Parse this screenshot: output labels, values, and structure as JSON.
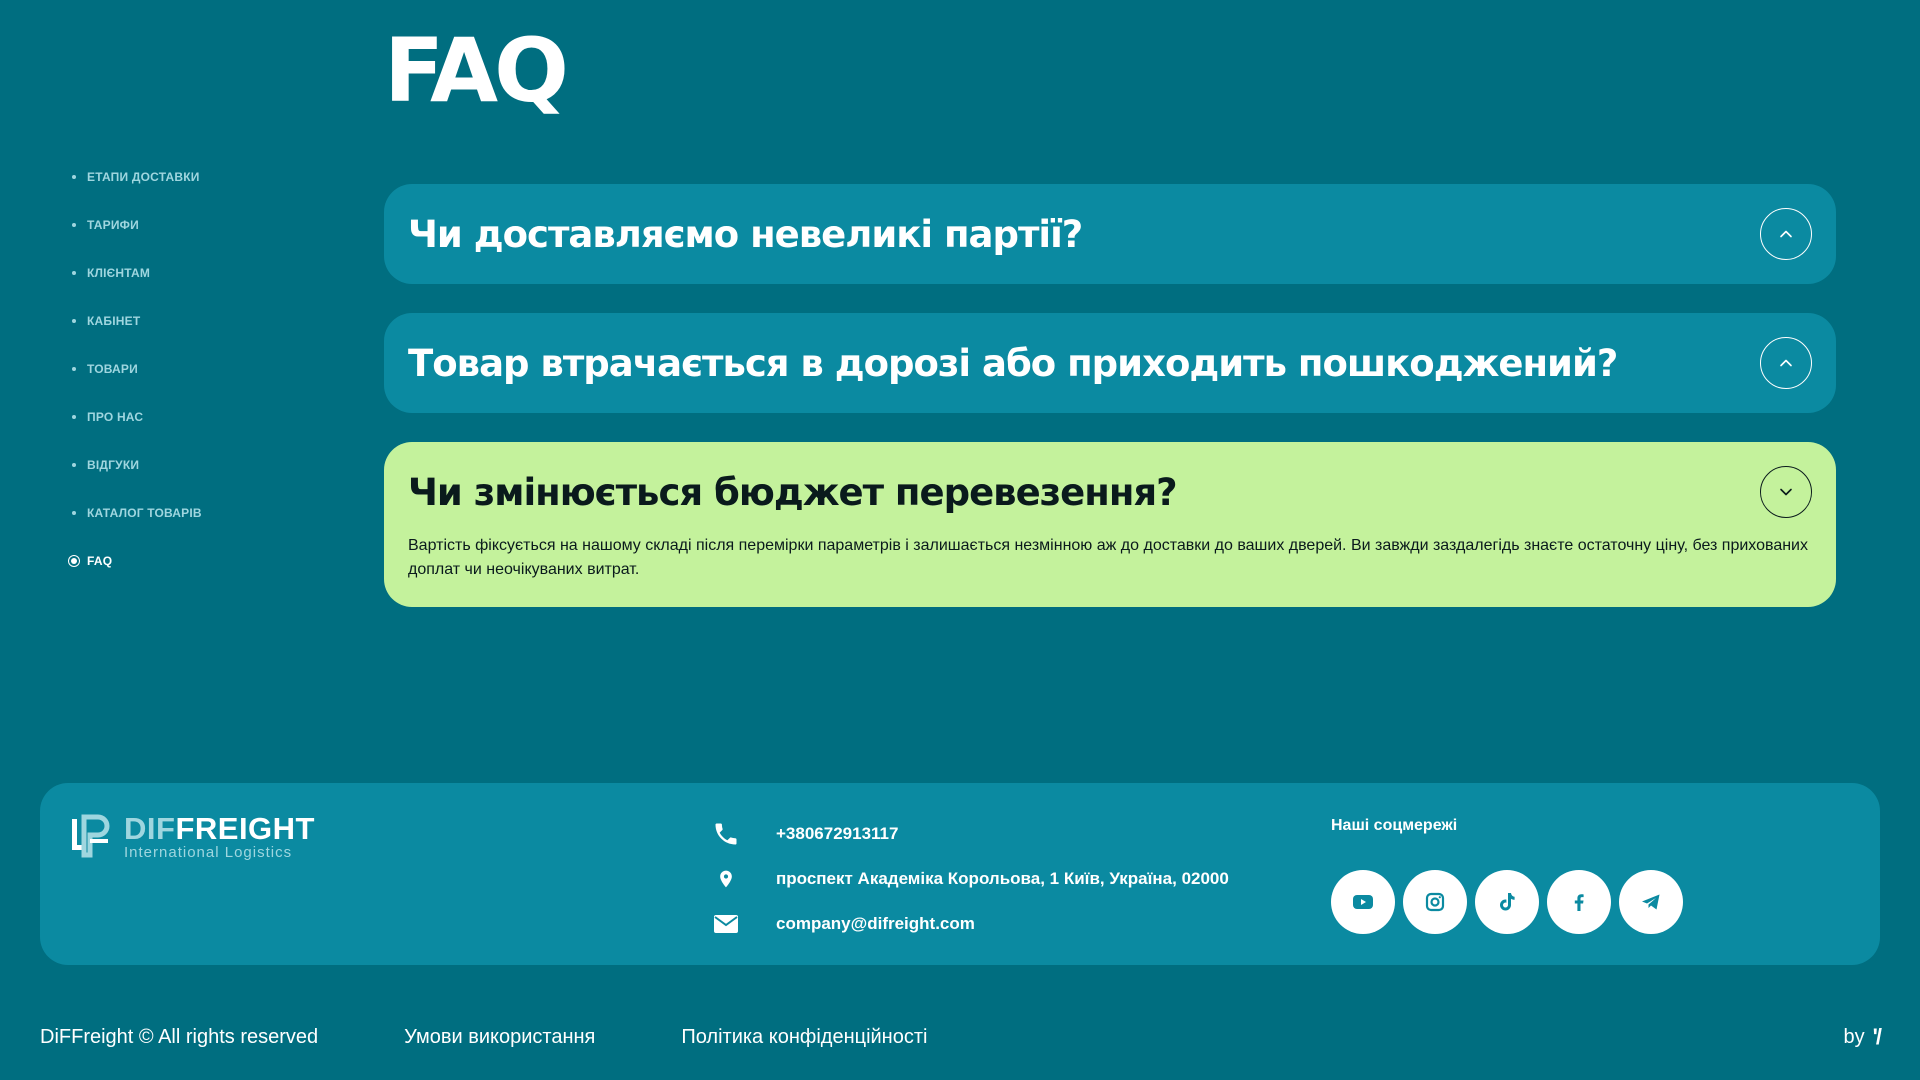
{
  "page": {
    "title": "FAQ"
  },
  "sidebar": {
    "items": [
      {
        "label": "ЕТАПИ ДОСТАВКИ"
      },
      {
        "label": "ТАРИФИ"
      },
      {
        "label": "КЛІЄНТАМ"
      },
      {
        "label": "КАБІНЕТ"
      },
      {
        "label": "ТОВАРИ"
      },
      {
        "label": "ПРО НАС"
      },
      {
        "label": "ВІДГУКИ"
      },
      {
        "label": "КАТАЛОГ ТОВАРІВ"
      },
      {
        "label": "FAQ",
        "active": true
      }
    ]
  },
  "faq": {
    "items": [
      {
        "question": "Чи доставляємо невеликі партії?",
        "expanded": false
      },
      {
        "question": "Товар втрачається в дорозі або приходить пошкоджений?",
        "expanded": false
      },
      {
        "question": "Чи змінюється бюджет перевезення?",
        "expanded": true,
        "answer": "Вартість фіксується на нашому складі після перемірки параметрів і залишається незмінною аж до доставки до ваших дверей. Ви завжди заздалегідь знаєте остаточну ціну, без прихованих доплат чи неочікуваних витрат."
      }
    ]
  },
  "footer": {
    "logo": {
      "brand_part1": "DIF",
      "brand_part2": "FREIGHT",
      "tagline": "International Logistics"
    },
    "contacts": {
      "phone": "+380672913117",
      "address": "проспект Академіка Корольова, 1 Київ, Україна, 02000",
      "email": "company@difreight.com"
    },
    "social_title": "Наші соцмережі",
    "socials": [
      "youtube-icon",
      "instagram-icon",
      "tiktok-icon",
      "facebook-icon",
      "telegram-icon"
    ]
  },
  "bottom": {
    "copyright": "DiFFreight © All rights reserved",
    "terms": "Умови використання",
    "privacy": "Політика конфіденційності",
    "by": "by",
    "by_mark": "'/"
  },
  "colors": {
    "background": "#006e80",
    "card": "#0b8aa1",
    "expanded_card": "#c4f29c",
    "text": "#ffffff"
  }
}
